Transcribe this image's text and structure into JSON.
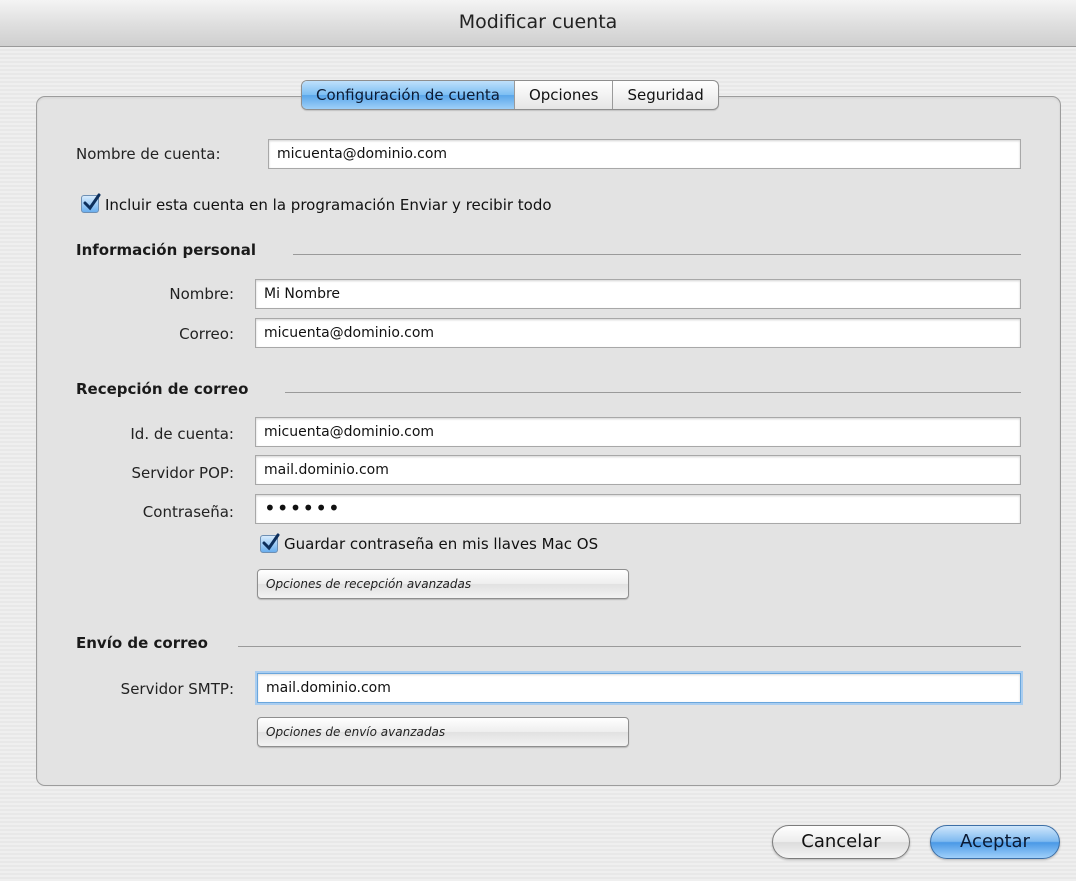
{
  "window": {
    "title": "Modificar cuenta"
  },
  "tabs": [
    {
      "label": "Configuración de cuenta",
      "active": true
    },
    {
      "label": "Opciones",
      "active": false
    },
    {
      "label": "Seguridad",
      "active": false
    }
  ],
  "account": {
    "name_label": "Nombre de cuenta:",
    "name_value": "micuenta@dominio.com",
    "include_checked": true,
    "include_label": "Incluir esta cuenta en la programación Enviar y recibir todo"
  },
  "personal": {
    "heading": "Información personal",
    "name_label": "Nombre:",
    "name_value": "Mi Nombre",
    "email_label": "Correo:",
    "email_value": "micuenta@dominio.com"
  },
  "incoming": {
    "heading": "Recepción de correo",
    "account_id_label": "Id. de cuenta:",
    "account_id_value": "micuenta@dominio.com",
    "pop_label": "Servidor POP:",
    "pop_value": "mail.dominio.com",
    "password_label": "Contraseña:",
    "password_mask": "••••••",
    "save_password_checked": true,
    "save_password_label": "Guardar contraseña en mis llaves Mac OS",
    "advanced_button": "Opciones de recepción avanzadas"
  },
  "outgoing": {
    "heading": "Envío de correo",
    "smtp_label": "Servidor SMTP:",
    "smtp_value": "mail.dominio.com",
    "advanced_button": "Opciones de envío avanzadas"
  },
  "footer": {
    "cancel_label": "Cancelar",
    "ok_label": "Aceptar"
  },
  "colors": {
    "accent": "#5aa6ea",
    "panel": "#e3e3e3"
  }
}
